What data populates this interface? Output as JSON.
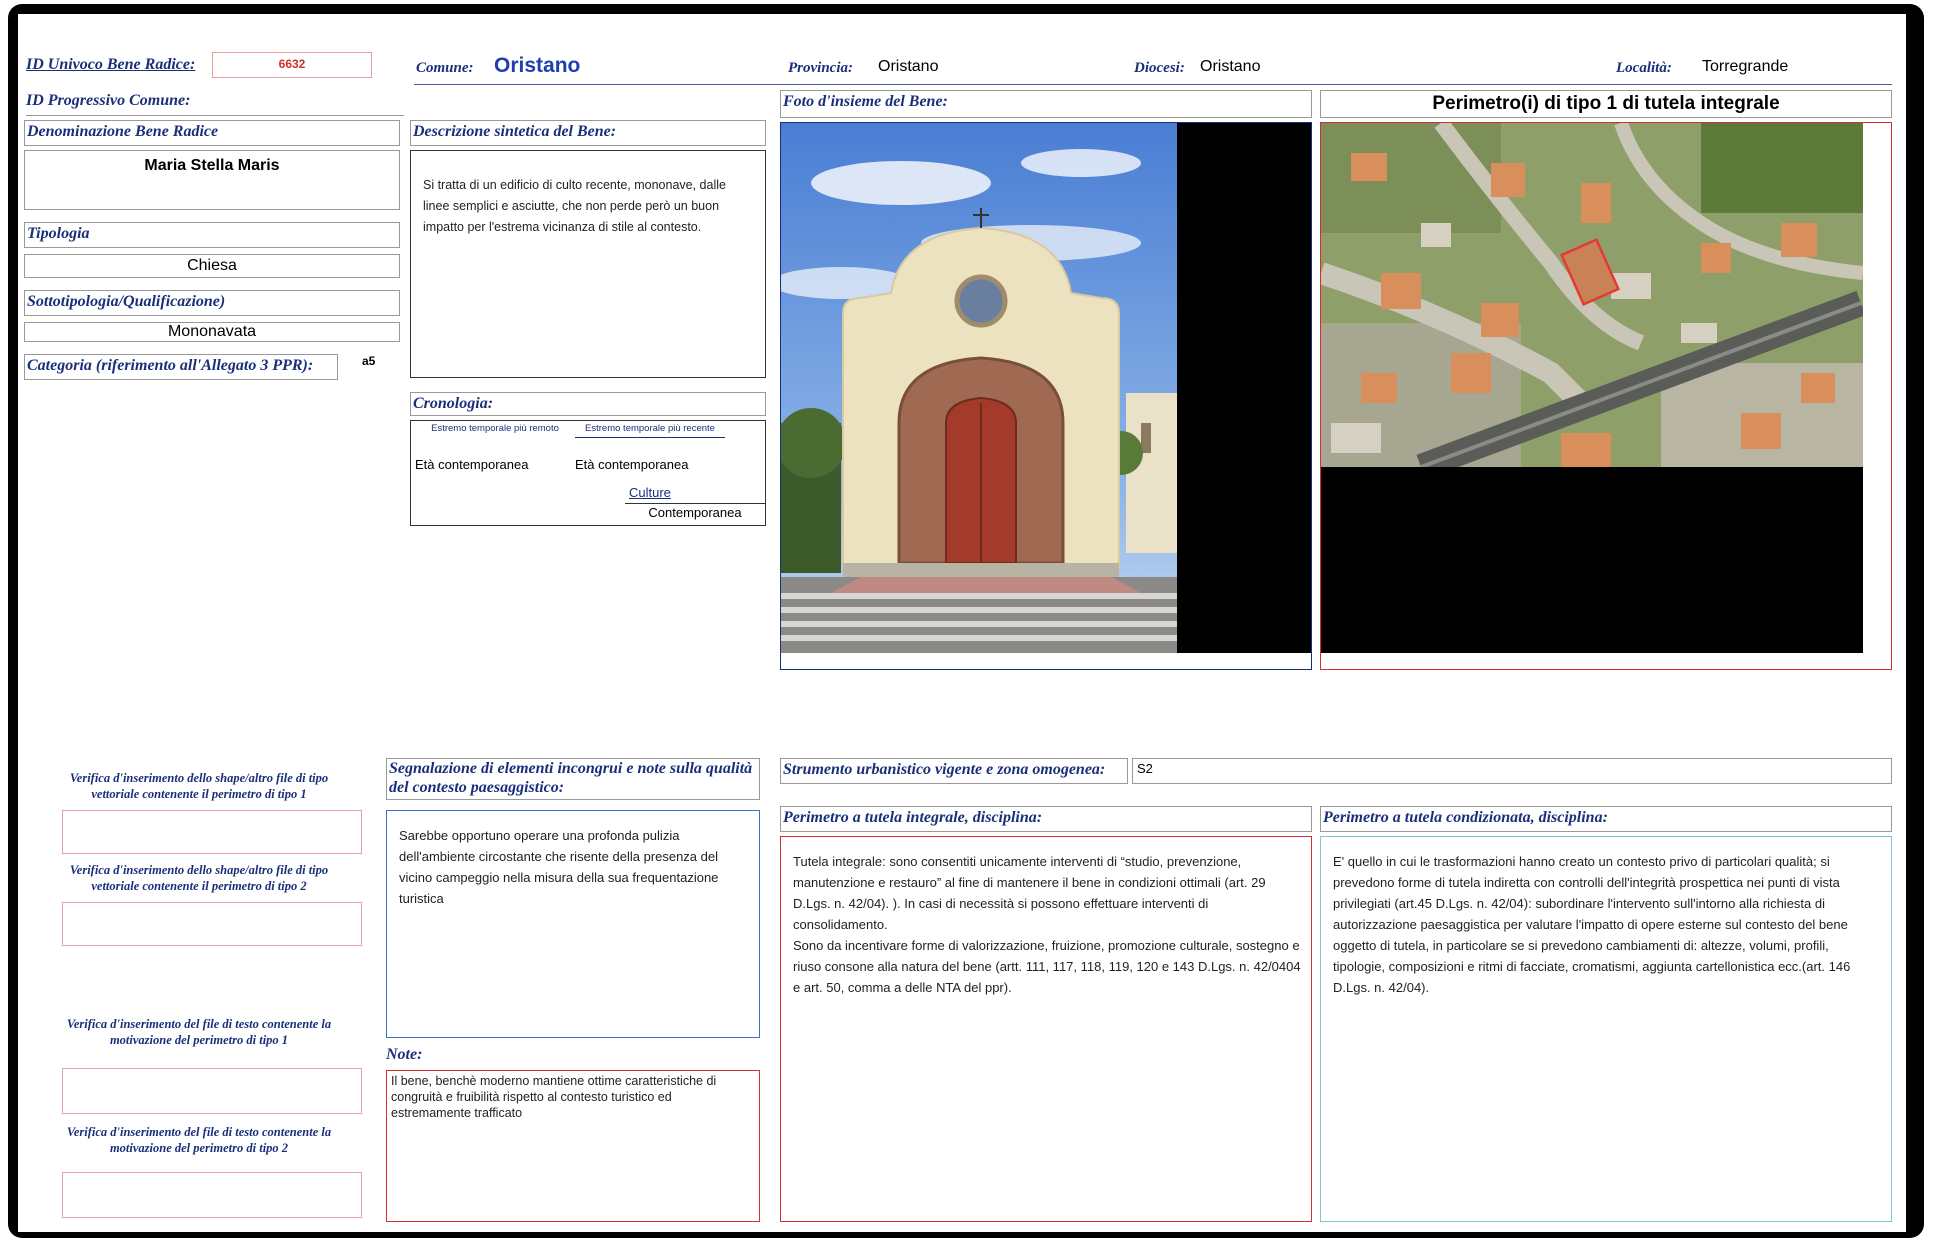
{
  "header": {
    "id_univoco_label": "ID Univoco Bene Radice:",
    "id_univoco_value": "6632",
    "comune_label": "Comune:",
    "comune_value": "Oristano",
    "provincia_label": "Provincia:",
    "provincia_value": "Oristano",
    "diocesi_label": "Diocesi:",
    "diocesi_value": "Oristano",
    "localita_label": "Località:",
    "localita_value": "Torregrande"
  },
  "left": {
    "id_progressivo_label": "ID Progressivo Comune:",
    "denominazione_label": "Denominazione Bene Radice",
    "denominazione_value": "Maria Stella Maris",
    "tipologia_label": "Tipologia",
    "tipologia_value": "Chiesa",
    "sottotipologia_label": "Sottotipologia/Qualificazione)",
    "sottotipologia_value": "Mononavata",
    "categoria_label": "Categoria (riferimento all'Allegato 3 PPR):",
    "categoria_value": "a5"
  },
  "descrizione": {
    "label": "Descrizione sintetica del Bene:",
    "text": "Si tratta di un edificio di culto recente, mononave, dalle linee semplici e asciutte, che non perde però un buon impatto per l'estrema vicinanza di stile al contesto."
  },
  "cronologia": {
    "label": "Cronologia:",
    "col1_header": "Estremo temporale più remoto",
    "col2_header": "Estremo temporale più recente",
    "col1_value": "Età contemporanea",
    "col2_value": "Età contemporanea",
    "culture_label": "Culture",
    "culture_value": "Contemporanea"
  },
  "foto": {
    "label": "Foto d'insieme del Bene:"
  },
  "perimetro": {
    "title": "Perimetro(i) di tipo 1 di tutela integrale"
  },
  "verifica": {
    "v1": "Verifica d'inserimento dello shape/altro file di tipo vettoriale contenente il perimetro di tipo 1",
    "v2": "Verifica d'inserimento dello shape/altro file di tipo vettoriale contenente il perimetro di tipo 2",
    "v3": "Verifica d'inserimento del  file di testo contenente la motivazione del perimetro di tipo 1",
    "v4": "Verifica d'inserimento del  file di testo contenente la motivazione del perimetro di tipo 2"
  },
  "segnalazione": {
    "label": "Segnalazione di elementi incongrui e note sulla qualità del contesto paesaggistico:",
    "text": "Sarebbe opportuno operare una profonda pulizia dell'ambiente circostante che risente della presenza del vicino campeggio nella misura della sua frequentazione turistica"
  },
  "note": {
    "label": "Note:",
    "text": "Il bene, benchè moderno mantiene ottime caratteristiche di congruità e fruibilità rispetto al contesto turistico ed estremamente trafficato"
  },
  "strumento": {
    "label": "Strumento urbanistico vigente e zona omogenea:",
    "value": "S2"
  },
  "tutela_integrale": {
    "label": "Perimetro a tutela integrale, disciplina:",
    "text1": "Tutela integrale: sono consentiti unicamente interventi di “studio, prevenzione, manutenzione e restauro”  al fine di mantenere il bene in  condizioni ottimali (art. 29 D.Lgs. n. 42/04). ). In casi di necessità si possono effettuare interventi di consolidamento.",
    "text2": "Sono da incentivare forme di valorizzazione, fruizione, promozione culturale, sostegno e riuso consone alla natura del bene (artt. 111, 117, 118, 119, 120 e   143 D.Lgs. n. 42/0404 e art. 50, comma a delle NTA del ppr)."
  },
  "tutela_condizionata": {
    "label": "Perimetro a tutela condizionata, disciplina:",
    "text": "E' quello in cui le trasformazioni hanno creato un contesto privo di particolari qualità; si prevedono  forme di tutela indiretta con controlli dell'integrità prospettica nei punti di vista privilegiati (art.45  D.Lgs. n. 42/04): subordinare l'intervento sull'intorno alla richiesta di autorizzazione paesaggistica per valutare l'impatto di opere esterne sul contesto del bene oggetto di tutela, in particolare se si prevedono cambiamenti di:  altezze, volumi, profili, tipologie, composizioni e ritmi di facciate, cromatismi, aggiunta cartellonistica ecc.(art. 146 D.Lgs. n. 42/04)."
  },
  "colors": {
    "label_blue": "#1a2f7a",
    "accent_red": "#d32f2f",
    "accent_blue": "#3b6fc9",
    "accent_cyan": "#7cc7cf"
  }
}
